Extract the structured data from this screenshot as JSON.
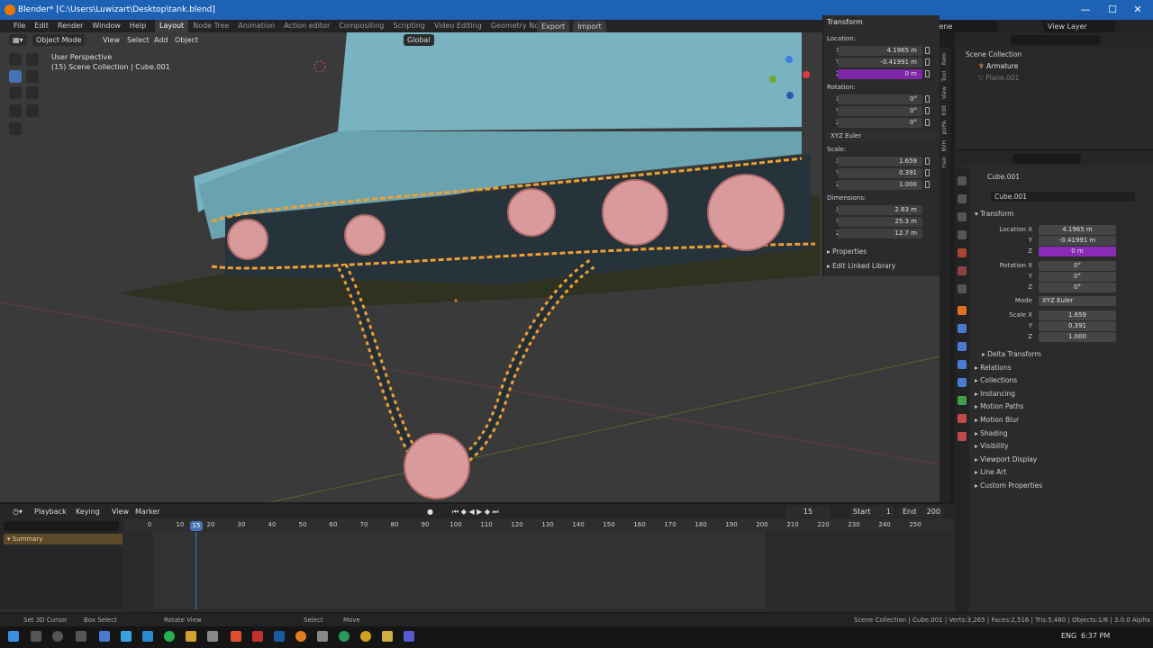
{
  "window": {
    "title": "Blender* [C:\\Users\\Luwizart\\Desktop\\tank.blend]",
    "min": "—",
    "max": "☐",
    "close": "✕"
  },
  "menu": {
    "items": [
      "File",
      "Edit",
      "Render",
      "Window",
      "Help"
    ],
    "workspaces": [
      "Layout",
      "Node Tree",
      "Animation",
      "Action editor",
      "Compositing",
      "Scripting",
      "Video Editing",
      "Geometry Nodes",
      "+"
    ],
    "export": "Export",
    "import": "Import",
    "scene": "Scene",
    "view_layer": "View Layer"
  },
  "viewport": {
    "mode": "Object Mode",
    "view": "View",
    "select": "Select",
    "add": "Add",
    "object": "Object",
    "orientation": "Global",
    "info_line1": "User Perspective",
    "info_line2": "(15) Scene Collection | Cube.001"
  },
  "npanel": {
    "transform": "Transform",
    "location": "Location:",
    "loc": [
      "4.1965 m",
      "-0.41991 m",
      "0 m"
    ],
    "rotation": "Rotation:",
    "rot": [
      "0°",
      "0°",
      "0°"
    ],
    "rot_mode": "XYZ Euler",
    "scale": "Scale:",
    "scl": [
      "1.659",
      "0.391",
      "1.000"
    ],
    "dimensions": "Dimensions:",
    "dim": [
      "2.83 m",
      "25.3 m",
      "12.7 m"
    ],
    "properties": "Properties",
    "edit_linked": "Edit Linked Library",
    "axes": [
      "X",
      "Y",
      "Z"
    ],
    "tabs": [
      "Item",
      "Tool",
      "View",
      "Edit",
      "pUPA",
      "BVH",
      "Hair"
    ]
  },
  "outliner": {
    "root": "Scene Collection",
    "items": [
      "Armature",
      "Plane.001"
    ]
  },
  "props": {
    "object": "Cube.001",
    "object2": "Cube.001",
    "transform": "Transform",
    "location_x": "Location X",
    "loc": [
      "4.1965 m",
      "-0.41991 m",
      "0 m"
    ],
    "rotation_x": "Rotation X",
    "rot": [
      "0°",
      "0°",
      "0°"
    ],
    "mode_label": "Mode",
    "mode": "XYZ Euler",
    "scale_x": "Scale X",
    "scl": [
      "1.659",
      "0.391",
      "1.000"
    ],
    "y": "Y",
    "z": "Z",
    "delta": "Delta Transform",
    "sections": [
      "Relations",
      "Collections",
      "Instancing",
      "Motion Paths",
      "Motion Blur",
      "Shading",
      "Visibility",
      "Viewport Display",
      "Line Art",
      "Custom Properties"
    ]
  },
  "timeline": {
    "playback": "Playback",
    "keying": "Keying",
    "view": "View",
    "marker": "Marker",
    "current": "15",
    "start_label": "Start",
    "start": "1",
    "end_label": "End",
    "end": "200",
    "frame_badge": "15",
    "summary": "Summary",
    "ticks": [
      "0",
      "10",
      "20",
      "30",
      "40",
      "50",
      "60",
      "70",
      "80",
      "90",
      "100",
      "110",
      "120",
      "130",
      "140",
      "150",
      "160",
      "170",
      "180",
      "190",
      "200",
      "210",
      "220",
      "230",
      "240",
      "250"
    ]
  },
  "status": {
    "left1": "Set 3D Cursor",
    "left2": "Box Select",
    "left3": "Rotate View",
    "left4": "Select",
    "left5": "Move",
    "right": "Scene Collection | Cube.001 | Verts:3,265 | Faces:2,516 | Tris:5,480 | Objects:1/6 | 3.0.0 Alpha"
  },
  "taskbar": {
    "lang": "ENG",
    "time": "6:37 PM"
  },
  "colors": {
    "accent": "#4772b3",
    "highlight": "#7c25a6",
    "select": "#f0a030",
    "titlebar": "#1e62b6"
  }
}
